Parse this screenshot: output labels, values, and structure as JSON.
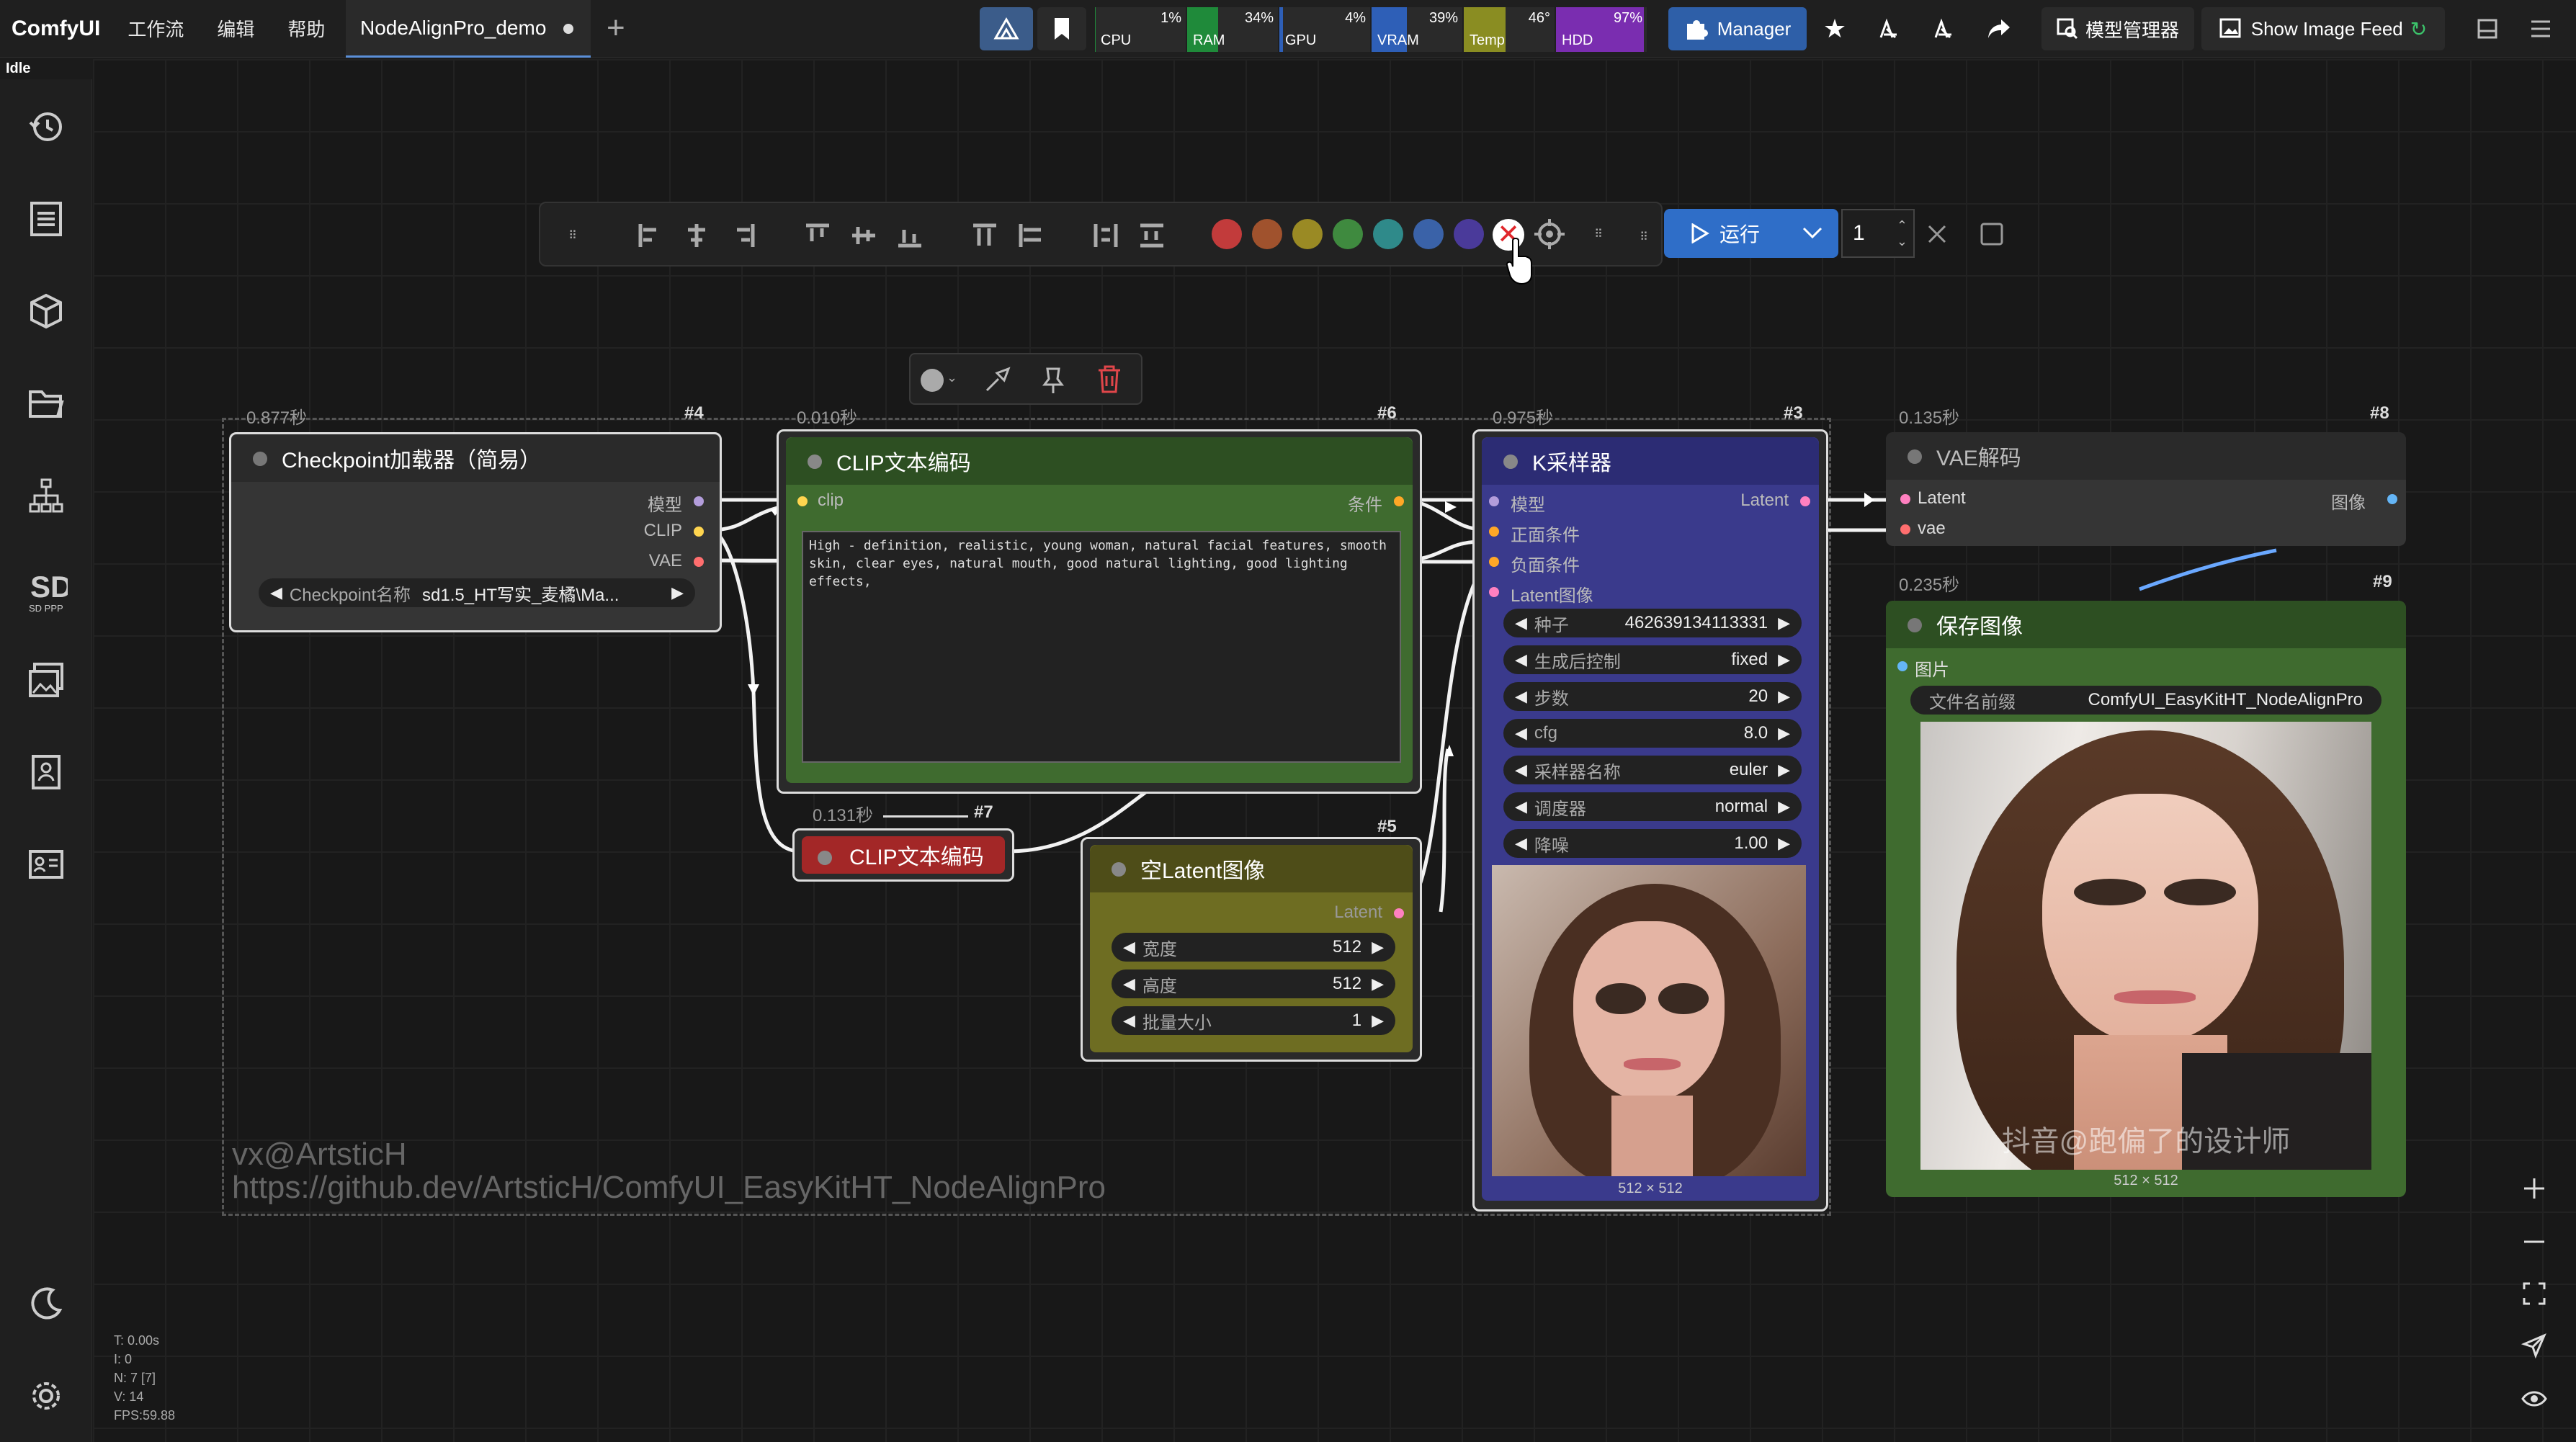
{
  "app": {
    "brand": "ComfyUI",
    "status": "Idle"
  },
  "menu": [
    "工作流",
    "编辑",
    "帮助"
  ],
  "tab": {
    "title": "NodeAlignPro_demo"
  },
  "meters": [
    {
      "label": "CPU",
      "pct": "1%",
      "color": "#1f8a3a",
      "fill": 0.01
    },
    {
      "label": "RAM",
      "pct": "34%",
      "color": "#1f8a3a",
      "fill": 0.34
    },
    {
      "label": "GPU",
      "pct": "4%",
      "color": "#2e5fb7",
      "fill": 0.04
    },
    {
      "label": "VRAM",
      "pct": "39%",
      "color": "#2e5fb7",
      "fill": 0.39
    },
    {
      "label": "Temp",
      "pct": "46°",
      "color": "#8a8d22",
      "fill": 0.46
    },
    {
      "label": "HDD",
      "pct": "97%",
      "color": "#7a2db0",
      "fill": 0.97
    }
  ],
  "topbar": {
    "manager": "Manager",
    "model_manager": "模型管理器",
    "image_feed": "Show Image Feed"
  },
  "floatbar": {
    "run": "运行",
    "queue_count": "1",
    "colors": [
      "#c23b3b",
      "#a0522d",
      "#9a8a24",
      "#3f8a3f",
      "#2f8a8a",
      "#3a62a8",
      "#4a3a9a"
    ]
  },
  "nodes": {
    "checkpoint": {
      "time": "0.877秒",
      "id": "#4",
      "title": "Checkpoint加载器（简易）",
      "outputs": [
        "模型",
        "CLIP",
        "VAE"
      ],
      "widget_label": "Checkpoint名称",
      "widget_value": "sd1.5_HT写实_麦橘\\Ma..."
    },
    "clip_pos": {
      "time": "0.010秒",
      "id": "#6",
      "title": "CLIP文本编码",
      "input": "clip",
      "output": "条件",
      "prompt": "High - definition, realistic, young woman, natural facial features, smooth skin, clear eyes, natural mouth, good natural lighting, good lighting effects,"
    },
    "clip_neg": {
      "time": "0.131秒",
      "id": "#7",
      "title": "CLIP文本编码"
    },
    "latent": {
      "id": "#5",
      "title": "空Latent图像",
      "output": "Latent",
      "widgets": [
        {
          "label": "宽度",
          "value": "512"
        },
        {
          "label": "高度",
          "value": "512"
        },
        {
          "label": "批量大小",
          "value": "1"
        }
      ]
    },
    "ksampler": {
      "time": "0.975秒",
      "id": "#3",
      "title": "K采样器",
      "inputs": [
        "模型",
        "正面条件",
        "负面条件",
        "Latent图像"
      ],
      "output": "Latent",
      "widgets": [
        {
          "label": "种子",
          "value": "462639134113331"
        },
        {
          "label": "生成后控制",
          "value": "fixed"
        },
        {
          "label": "步数",
          "value": "20"
        },
        {
          "label": "cfg",
          "value": "8.0"
        },
        {
          "label": "采样器名称",
          "value": "euler"
        },
        {
          "label": "调度器",
          "value": "normal"
        },
        {
          "label": "降噪",
          "value": "1.00"
        }
      ],
      "preview_size": "512 × 512"
    },
    "vae": {
      "time": "0.135秒",
      "id": "#8",
      "title": "VAE解码",
      "inputs": [
        "Latent",
        "vae"
      ],
      "output": "图像"
    },
    "save": {
      "time": "0.235秒",
      "id": "#9",
      "title": "保存图像",
      "input": "图片",
      "widget_label": "文件名前缀",
      "widget_value": "ComfyUI_EasyKitHT_NodeAlignPro",
      "image_caption": "抖音@跑偏了的设计师",
      "preview_size": "512 × 512"
    }
  },
  "watermark": {
    "line1": "vx@ArtsticH",
    "line2": "https://github.dev/ArtsticH/ComfyUI_EasyKitHT_NodeAlignPro"
  },
  "stats": [
    "T: 0.00s",
    "I: 0",
    "N: 7 [7]",
    "V: 14",
    "FPS:59.88"
  ]
}
